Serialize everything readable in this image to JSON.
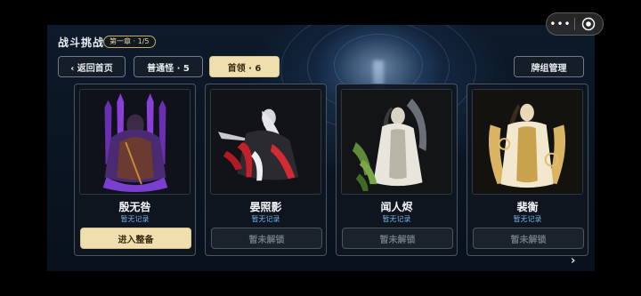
{
  "header": {
    "title": "战斗挑战",
    "chapter": "第一章 · 1/5"
  },
  "nav": {
    "back_label": "‹ 返回首页",
    "tab_normal": "普通怪 · 5",
    "tab_boss": "首领 · 6",
    "deck_label": "牌组管理"
  },
  "cards": [
    {
      "name": "殷无咎",
      "record": "暂无记录",
      "button": "进入整备",
      "unlocked": true
    },
    {
      "name": "晏照影",
      "record": "暂无记录",
      "button": "暂未解锁",
      "unlocked": false
    },
    {
      "name": "闻人烬",
      "record": "暂无记录",
      "button": "暂未解锁",
      "unlocked": false
    },
    {
      "name": "裴衡",
      "record": "暂无记录",
      "button": "暂未解锁",
      "unlocked": false
    }
  ],
  "pager": {
    "next": "›"
  },
  "capsule": {
    "more": "•••"
  },
  "colors": {
    "accent_gold": "#f0dfae",
    "record_blue": "#6fb0e4",
    "card_border": "#4a5563"
  }
}
